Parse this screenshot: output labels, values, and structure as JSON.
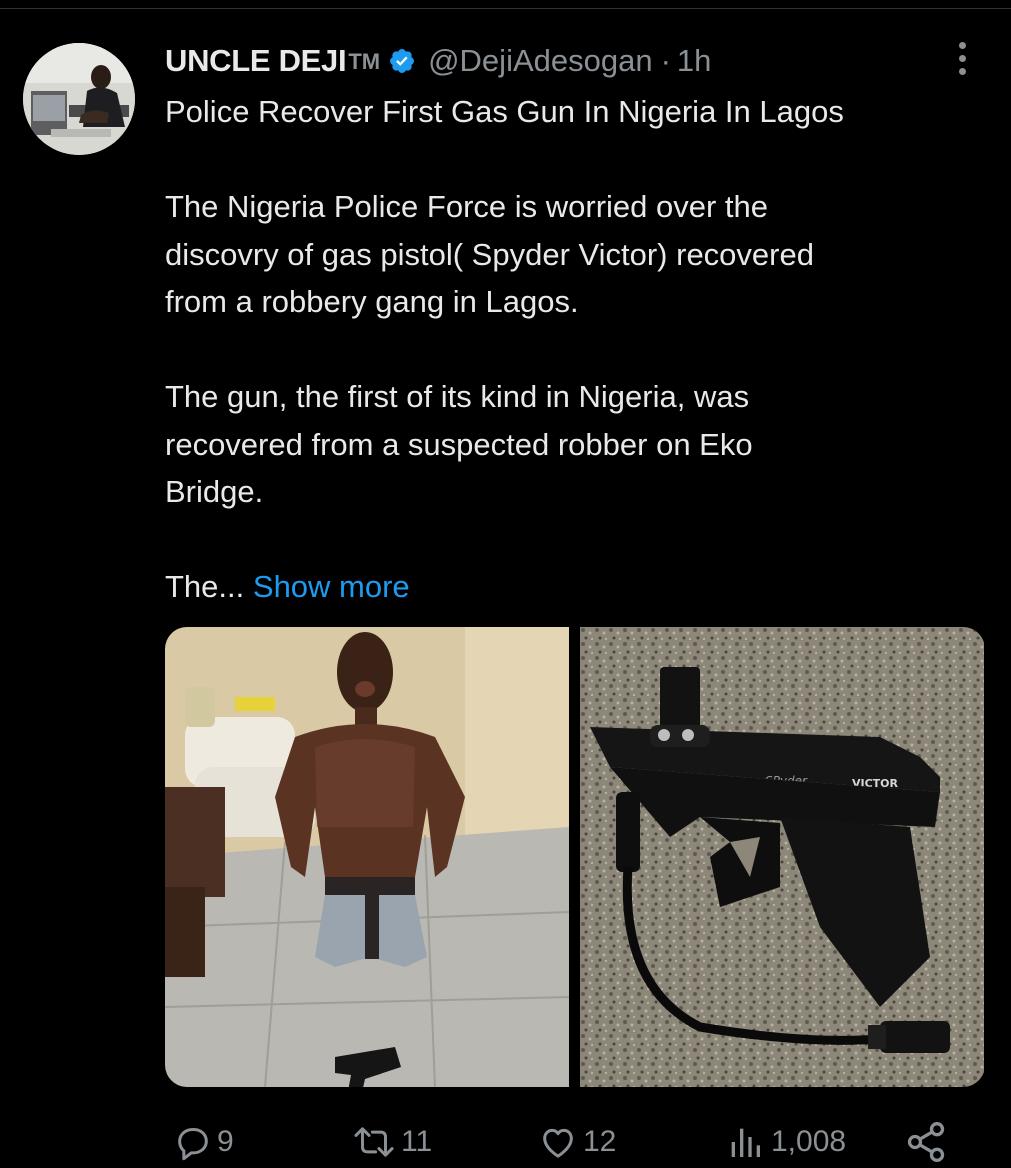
{
  "tweet": {
    "author_name": "UNCLE DEJI",
    "author_tm": "TM",
    "handle": "@DejiAdesogan",
    "separator": "·",
    "time_ago": "1h",
    "paragraphs": [
      "Police Recover First Gas Gun In Nigeria In Lagos",
      "The Nigeria Police Force is worried over the\ndiscovry of gas pistol( Spyder Victor) recovered\nfrom a robbery gang in Lagos.",
      "The gun, the first of its kind in Nigeria, was\nrecovered from a suspected robber on Eko\nBridge."
    ],
    "truncated_text": "The...",
    "show_more_label": "Show more"
  },
  "media": {
    "photo_2_brand": "SPyder",
    "photo_2_model": "VICTOR"
  },
  "actions": {
    "replies": "9",
    "reposts": "11",
    "likes": "12",
    "views": "1,008"
  },
  "colors": {
    "background": "#000000",
    "text_primary": "#e7e9ea",
    "text_secondary": "#8b9095",
    "link_blue": "#1d9bf0",
    "verified_blue": "#1d9bf0"
  },
  "icons": {
    "verified": "verified-badge-icon",
    "more": "more-options-icon",
    "reply": "reply-icon",
    "repost": "repost-icon",
    "like": "heart-icon",
    "views": "views-chart-icon",
    "share": "share-icon"
  }
}
